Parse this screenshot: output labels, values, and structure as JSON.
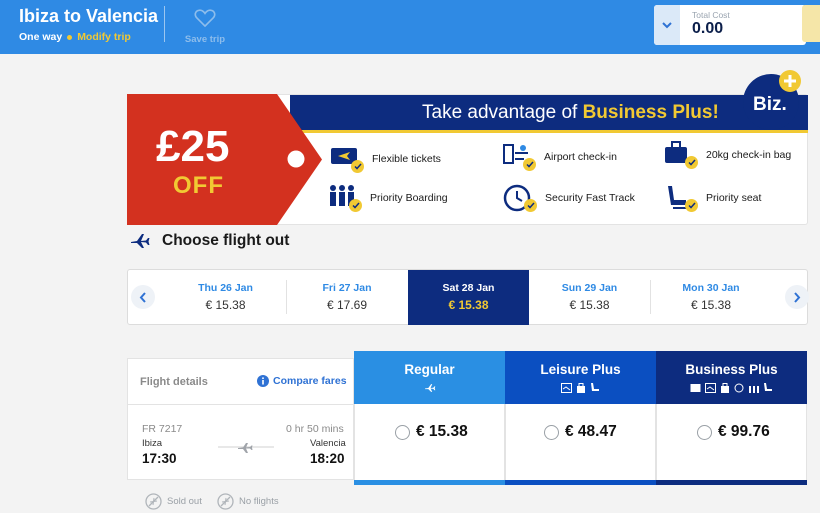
{
  "header": {
    "route": "Ibiza to Valencia",
    "trip_type": "One way",
    "modify_label": "Modify trip",
    "save_label": "Save trip",
    "total_label": "Total Cost",
    "total_value": "0.00"
  },
  "banner": {
    "headline_prefix": "Take advantage of ",
    "headline_highlight": "Business Plus!",
    "discount_amount": "£25",
    "discount_off": "OFF",
    "logo_text": "Biz.",
    "perks": [
      {
        "label": "Flexible tickets",
        "icon": "ticket-icon"
      },
      {
        "label": "Airport check-in",
        "icon": "check-in-icon"
      },
      {
        "label": "20kg check-in bag",
        "icon": "bag-icon"
      },
      {
        "label": "Priority Boarding",
        "icon": "boarding-icon"
      },
      {
        "label": "Security Fast Track",
        "icon": "fast-track-icon"
      },
      {
        "label": "Priority seat",
        "icon": "seat-icon"
      }
    ]
  },
  "choose": {
    "title": "Choose flight out"
  },
  "dates": [
    {
      "day": "Thu 26 Jan",
      "price": "€ 15.38"
    },
    {
      "day": "Fri 27 Jan",
      "price": "€ 17.69"
    },
    {
      "day": "Sat 28 Jan",
      "price": "€ 15.38"
    },
    {
      "day": "Sun 29 Jan",
      "price": "€ 15.38"
    },
    {
      "day": "Mon 30 Jan",
      "price": "€ 15.38"
    }
  ],
  "selected_date_index": 2,
  "flight": {
    "details_label": "Flight details",
    "compare_label": "Compare fares",
    "number": "FR 7217",
    "duration": "0 hr 50 mins",
    "from": "Ibiza",
    "to": "Valencia",
    "departure": "17:30",
    "arrival": "18:20"
  },
  "fares": [
    {
      "name": "Regular",
      "price": "€ 15.38",
      "color": "#2a8fe3"
    },
    {
      "name": "Leisure Plus",
      "price": "€ 48.47",
      "color": "#0b4fc1"
    },
    {
      "name": "Business Plus",
      "price": "€ 99.76",
      "color": "#0d2c7f"
    }
  ],
  "legend": {
    "sold_out": "Sold out",
    "no_flights": "No flights"
  },
  "colors": {
    "header": "#2f8ae4",
    "navy": "#0d2c7f",
    "accent": "#f1c933",
    "tag_red": "#d3311f"
  }
}
